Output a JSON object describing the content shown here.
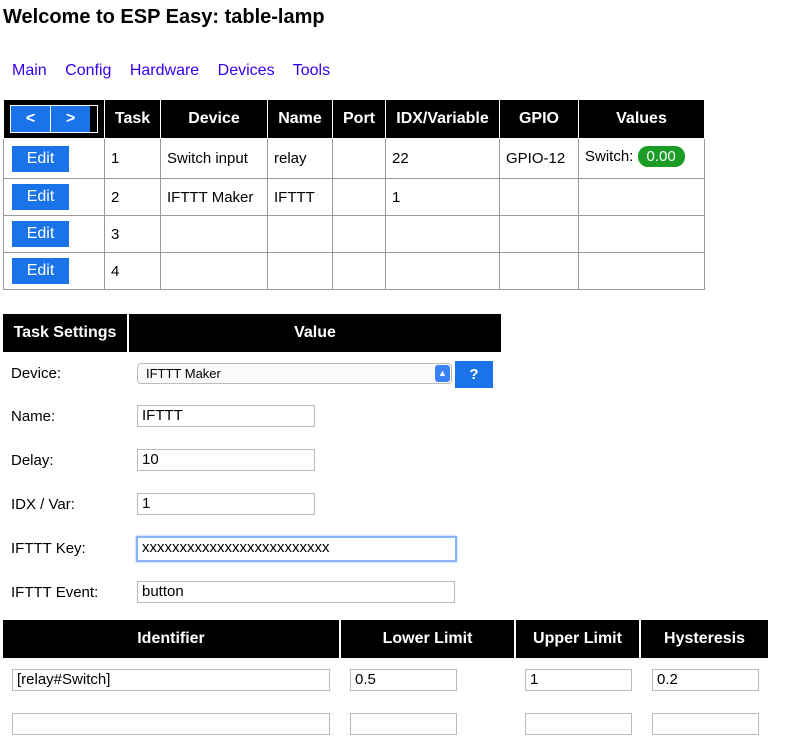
{
  "page": {
    "title": "Welcome to ESP Easy: table-lamp"
  },
  "nav": [
    "Main",
    "Config",
    "Hardware",
    "Devices",
    "Tools"
  ],
  "tasks": {
    "prev": "<",
    "next": ">",
    "headers": [
      "Task",
      "Device",
      "Name",
      "Port",
      "IDX/Variable",
      "GPIO",
      "Values"
    ],
    "edit_label": "Edit",
    "rows": [
      {
        "task": "1",
        "device": "Switch input",
        "name": "relay",
        "port": "",
        "idx": "22",
        "gpio": "GPIO-12",
        "value_label": "Switch:",
        "value": "0.00"
      },
      {
        "task": "2",
        "device": "IFTTT Maker",
        "name": "IFTTT",
        "port": "",
        "idx": "1",
        "gpio": "",
        "value_label": "",
        "value": ""
      },
      {
        "task": "3",
        "device": "",
        "name": "",
        "port": "",
        "idx": "",
        "gpio": "",
        "value_label": "",
        "value": ""
      },
      {
        "task": "4",
        "device": "",
        "name": "",
        "port": "",
        "idx": "",
        "gpio": "",
        "value_label": "",
        "value": ""
      }
    ],
    "badge_color": "#1a9c25"
  },
  "settings": {
    "headers": [
      "Task Settings",
      "Value"
    ],
    "device_label": "Device:",
    "device_value": "IFTTT Maker",
    "help": "?",
    "name_label": "Name:",
    "name_value": "IFTTT",
    "delay_label": "Delay:",
    "delay_value": "10",
    "idx_label": "IDX / Var:",
    "idx_value": "1",
    "key_label": "IFTTT Key:",
    "key_value": "xxxxxxxxxxxxxxxxxxxxxxxxx",
    "event_label": "IFTTT Event:",
    "event_value": "button"
  },
  "limits": {
    "headers": [
      "Identifier",
      "Lower Limit",
      "Upper Limit",
      "Hysteresis"
    ],
    "rows": [
      {
        "identifier": "[relay#Switch]",
        "lower": "0.5",
        "upper": "1",
        "hyst": "0.2"
      },
      {
        "identifier": "",
        "lower": "",
        "upper": "",
        "hyst": ""
      }
    ]
  },
  "colors": {
    "accent": "#1a73e8",
    "link": "#3300ee"
  }
}
